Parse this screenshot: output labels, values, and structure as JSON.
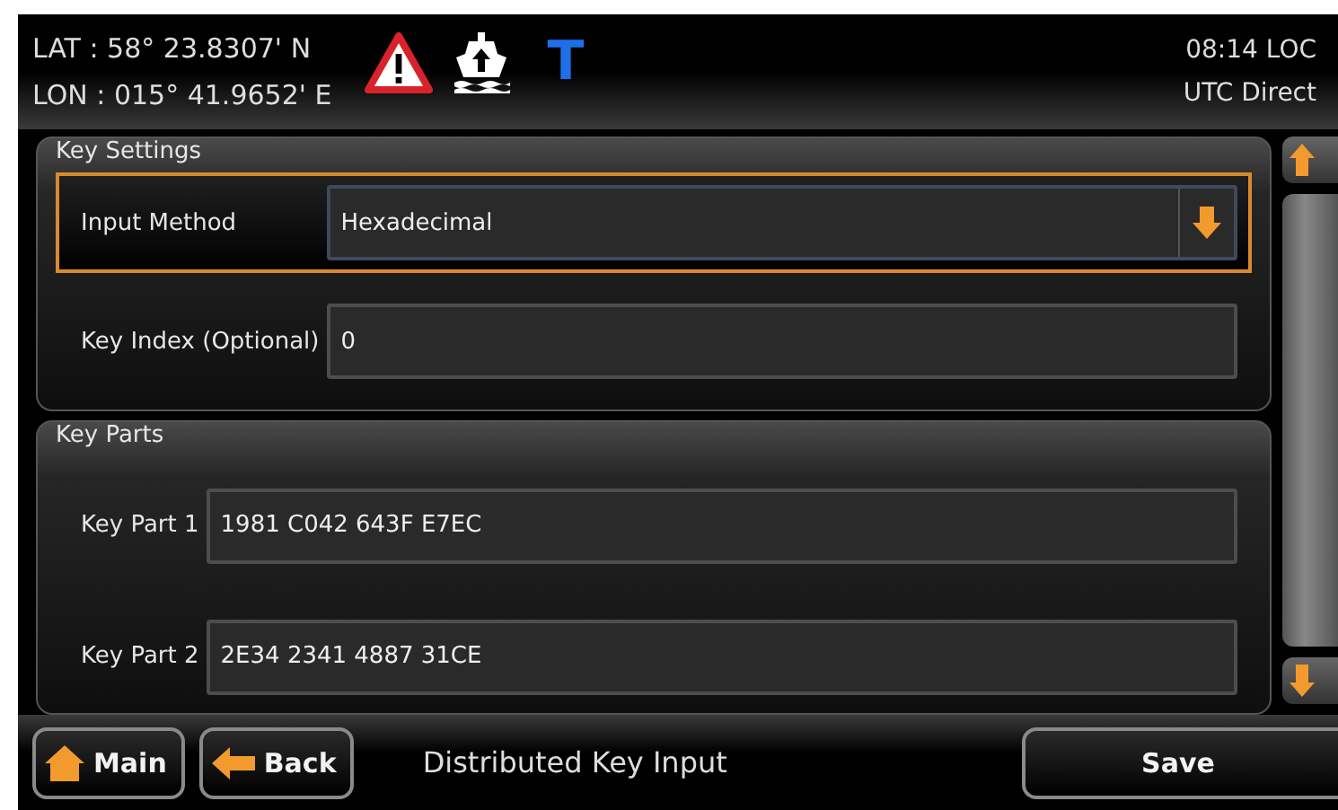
{
  "header": {
    "lat": "LAT : 58° 23.8307' N",
    "lon": "LON : 015° 41.9652' E",
    "mode_letter": "T",
    "time": "08:14 LOC",
    "time_source": "UTC Direct"
  },
  "sections": [
    {
      "title": "Key Settings",
      "fields": [
        {
          "kind": "dropdown",
          "label": "Input Method",
          "value": "Hexadecimal",
          "focused": true
        },
        {
          "kind": "text",
          "label": "Key Index (Optional)",
          "value": "0",
          "focused": false
        }
      ]
    },
    {
      "title": "Key Parts",
      "fields": [
        {
          "kind": "text",
          "label": "Key Part 1",
          "value": "1981 C042 643F E7EC",
          "focused": false
        },
        {
          "kind": "text",
          "label": "Key Part 2",
          "value": "2E34 2341 4887 31CE",
          "focused": false
        }
      ]
    }
  ],
  "footer": {
    "buttons": [
      {
        "kind": "home",
        "label": "Main"
      },
      {
        "kind": "back",
        "label": "Back"
      }
    ],
    "title": "Distributed Key Input",
    "action": "Save"
  }
}
